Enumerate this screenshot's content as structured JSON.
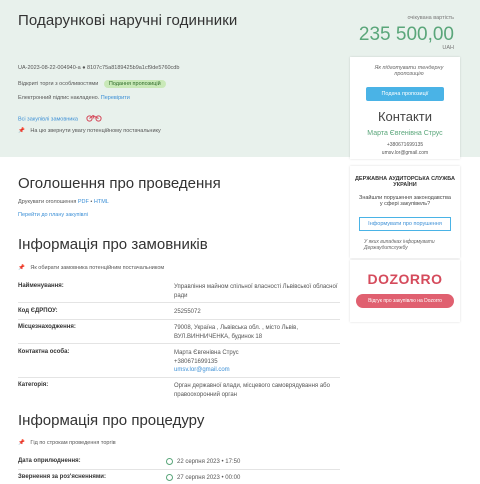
{
  "header": {
    "title": "Подарункові наручні годинники",
    "expected_value_label": "очікувана вартість",
    "amount": "235 500,00",
    "currency": "UAH",
    "tender_id": "UA-2023-08-22-004940-a  ●  8107c75a8189425b9a1cf9de5760cdb",
    "procurement_type": "Відкриті торги з особливостями",
    "status_badge": "Подання пропозицій",
    "signature_text": "Електронний підпис накладено.",
    "signature_link": "Перевірити",
    "buyers_link": "Всі закупівлі замовника",
    "monitoring_note": "На цю звернути увагу потенційному постачальнику"
  },
  "sidebar": {
    "note": "Як підготувати тендерну пропозицію",
    "submit_button": "Подача пропозиції",
    "contacts_heading": "Контакти",
    "contact_name": "Марта Євгенівна Струс",
    "contact_phone": "+380671699135",
    "contact_email": "umsv.lor@gmail.com"
  },
  "audit": {
    "title": "ДЕРЖАВНА АУДИТОРСЬКА СЛУЖБА УКРАЇНИ",
    "question": "Знайшли порушення законодавства у сфері закупівель?",
    "button": "Інформувати про порушення",
    "note": "У яких випадках інформувати Держаудитслужбу"
  },
  "dozorro": {
    "logo": "DOZORRO",
    "button": "Відгук про закупівлю на Dozorro"
  },
  "announcement": {
    "heading": "Оголошення про проведення",
    "print_label": "Друкувати оголошення",
    "print_pdf": "PDF",
    "print_html": "HTML",
    "plan_link": "Перейти до плану закупівлі"
  },
  "buyer_info": {
    "heading": "Інформація про замовників",
    "note": "Як обирати замовника потенційним постачальником",
    "rows": [
      {
        "label": "Найменування:",
        "value": "Управління майном спільної власності Львівської обласної ради"
      },
      {
        "label": "Код ЄДРПОУ:",
        "value": "25255072"
      },
      {
        "label": "Місцезнаходження:",
        "value": "79008, Україна , Львівська обл. , місто Львів, ВУЛ.ВИННИЧЕНКА, будинок 18"
      },
      {
        "label": "Контактна особа:",
        "value": "Марта Євгенівна Струс +380671699135",
        "link": "umsv.lor@gmail.com"
      },
      {
        "label": "Категорія:",
        "value": "Орган державної влади, місцевого самоврядування або правоохоронний орган"
      }
    ]
  },
  "procedure": {
    "heading": "Інформація про процедуру",
    "note": "Гід по строкам проведення торгів",
    "rows": [
      {
        "label": "Дата оприлюднення:",
        "value": "22 серпня 2023  •  17:50"
      },
      {
        "label": "Звернення за роз'ясненнями:",
        "value": "27 серпня 2023  •  00:00"
      }
    ]
  },
  "colors": {
    "header_band": "#e8f1ec",
    "accent_green": "#5aa67a",
    "link_blue": "#3b8fd6",
    "primary_button": "#4ab3e6",
    "dozorro_red": "#d54b5c"
  }
}
